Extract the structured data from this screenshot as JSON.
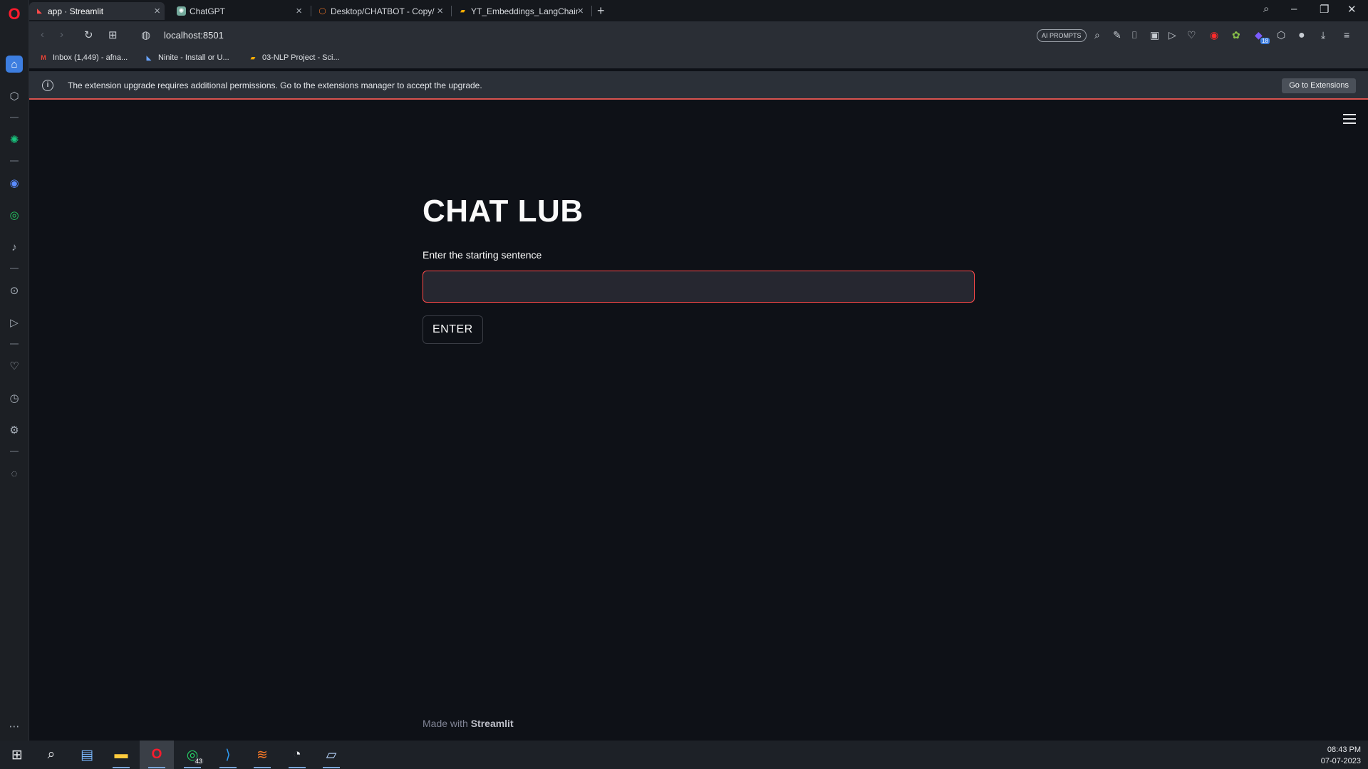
{
  "browser": {
    "tabs": [
      {
        "title": "app · Streamlit",
        "active": true
      },
      {
        "title": "ChatGPT",
        "active": false
      },
      {
        "title": "Desktop/CHATBOT - Copy/",
        "active": false
      },
      {
        "title": "YT_Embeddings_LangChain",
        "active": false
      }
    ],
    "new_tab": "+",
    "url": "localhost:8501",
    "ai_prompts_label": "AI PROMPTS",
    "bookmarks": [
      {
        "label": "Inbox (1,449) - afna..."
      },
      {
        "label": "Ninite - Install or U..."
      },
      {
        "label": "03-NLP Project - Sci..."
      }
    ],
    "extensions_badge": "18"
  },
  "infobar": {
    "message": "The extension upgrade requires additional permissions. Go to the extensions manager to accept the upgrade.",
    "button_label": "Go to Extensions"
  },
  "app": {
    "title": "CHAT LUB",
    "input_label": "Enter the starting sentence",
    "input_value": "",
    "input_placeholder": "",
    "button_label": "ENTER",
    "footer_prefix": "Made with",
    "footer_brand": "Streamlit"
  },
  "taskbar": {
    "whatsapp_badge": "43",
    "time": "08:43 PM",
    "date": "07-07-2023"
  },
  "colors": {
    "accent": "#ff4b4b",
    "background": "#0e1117",
    "opera_red": "#ff1b2d"
  }
}
